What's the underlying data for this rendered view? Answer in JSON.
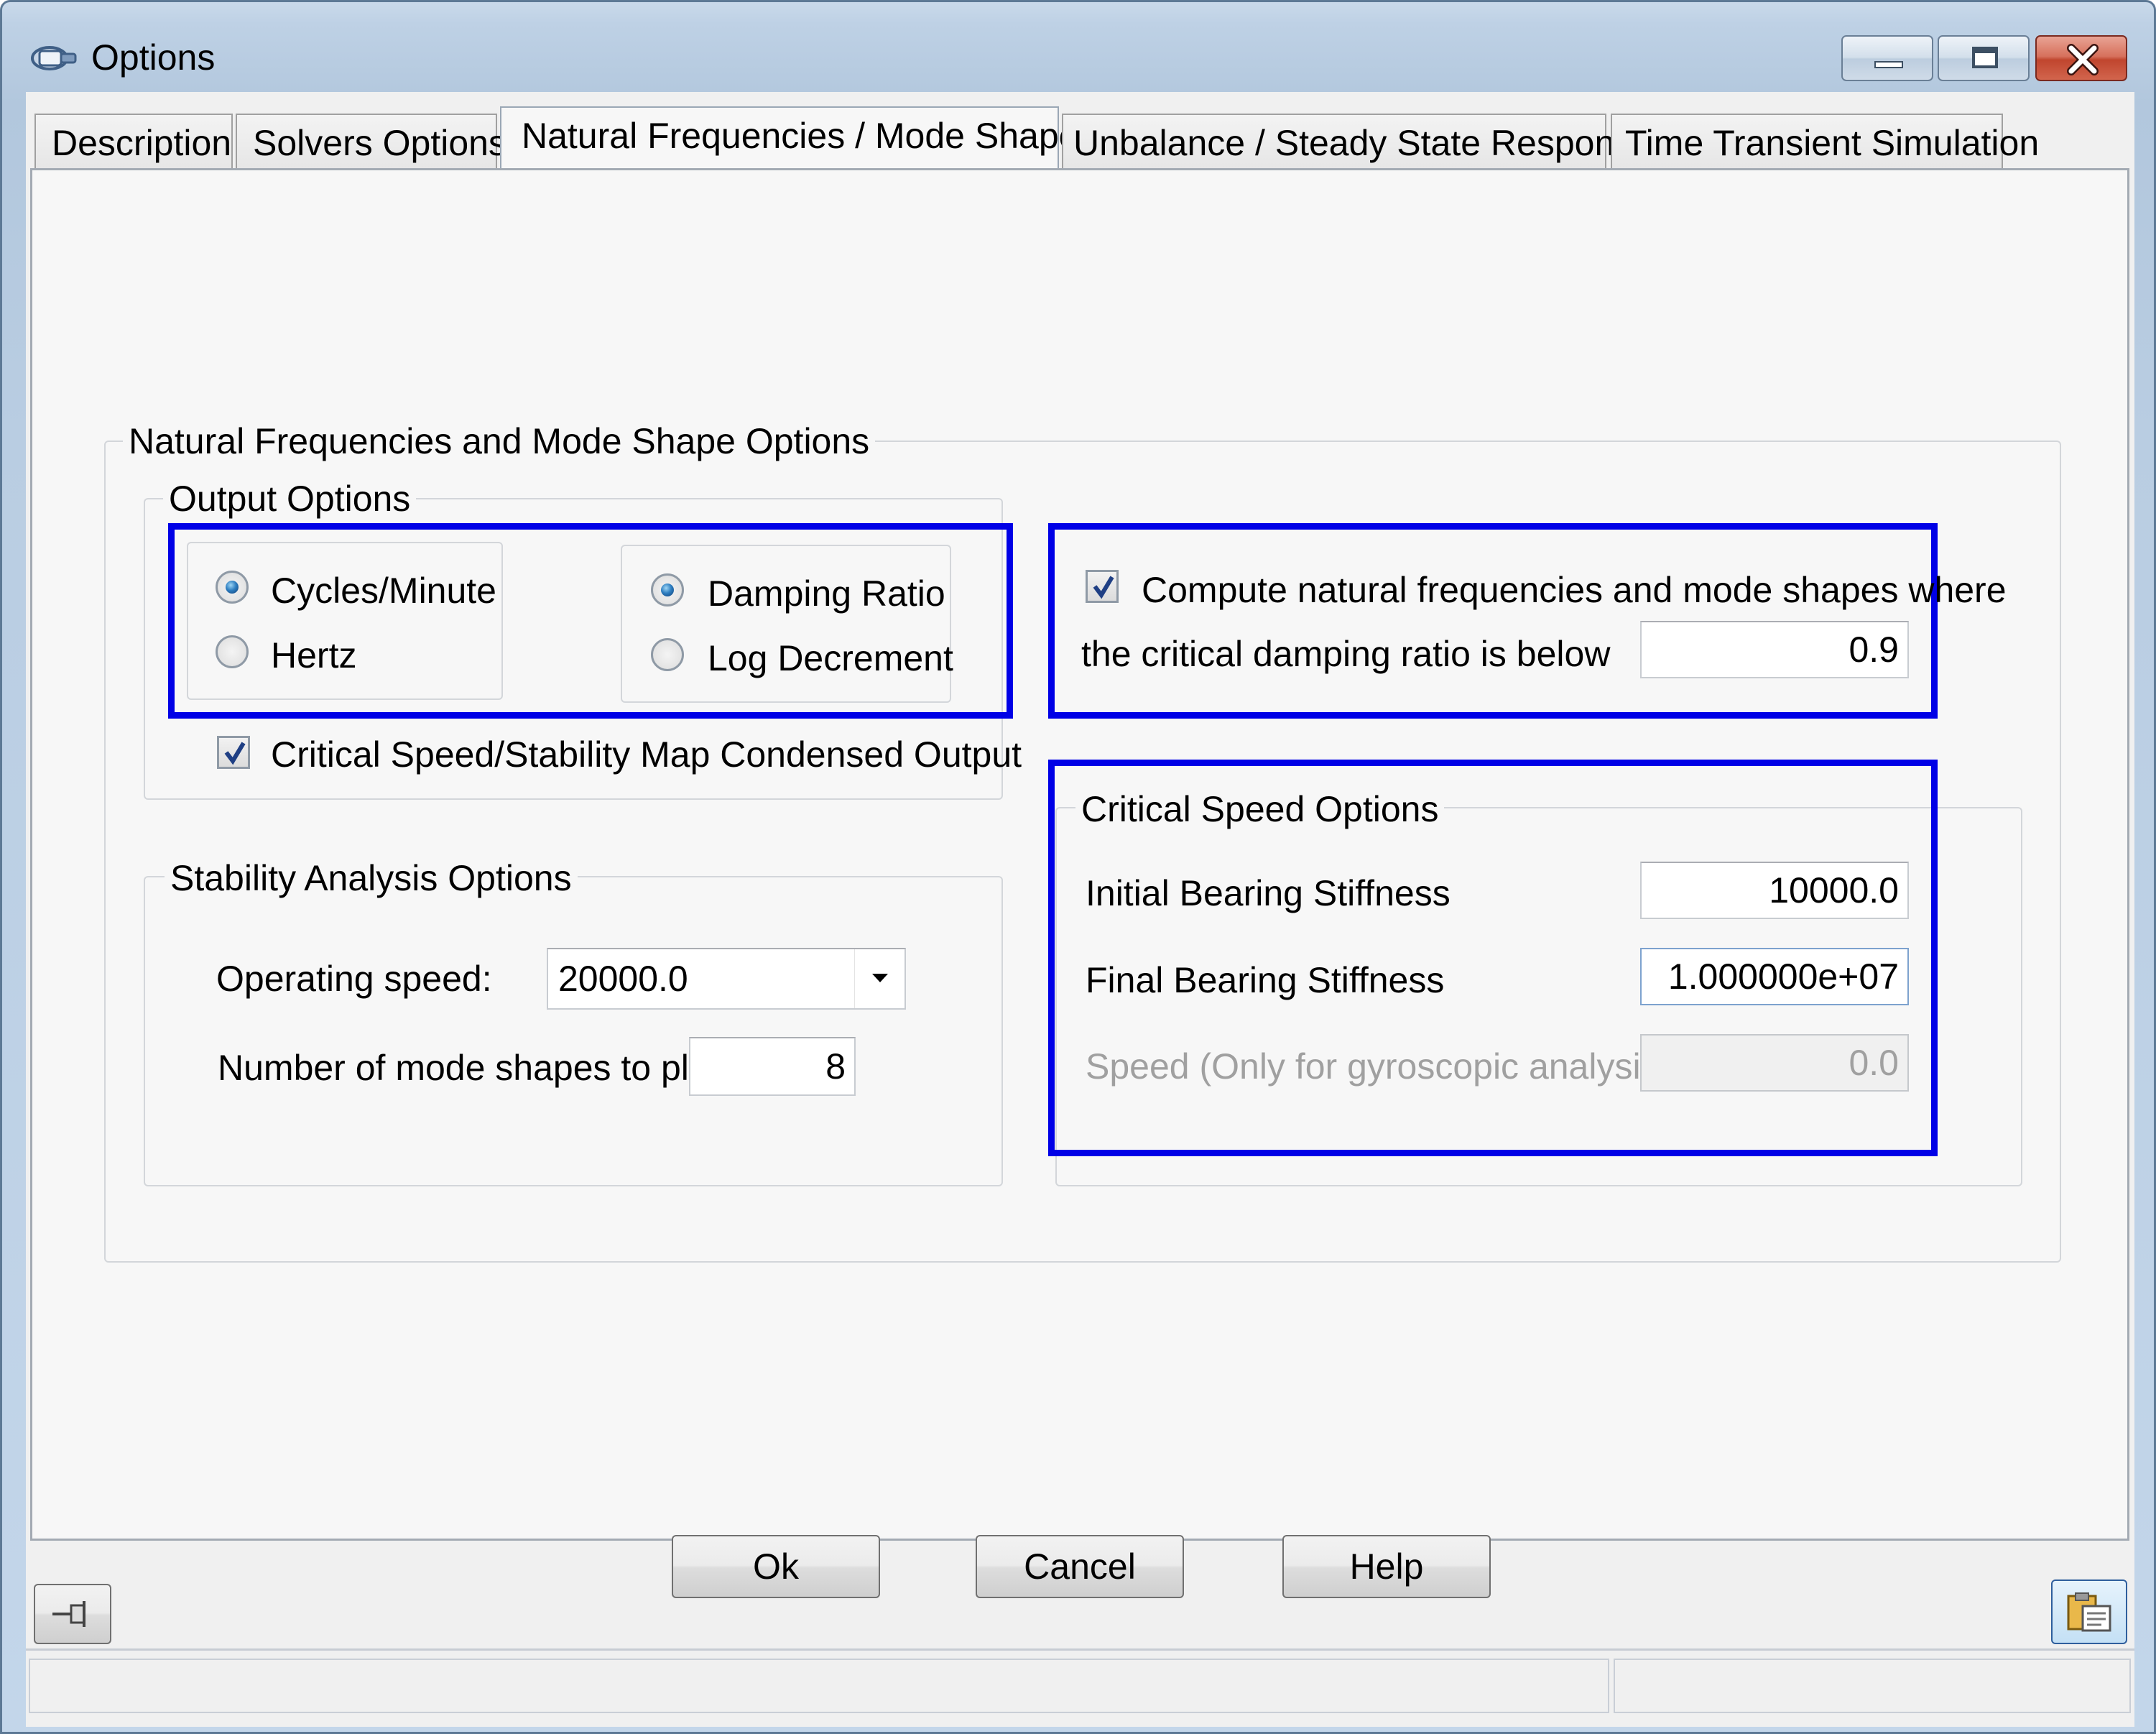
{
  "window": {
    "title": "Options"
  },
  "tabs": [
    {
      "label": "Description",
      "active": false
    },
    {
      "label": "Solvers Options",
      "active": false
    },
    {
      "label": "Natural Frequencies / Mode Shapes",
      "active": true
    },
    {
      "label": "Unbalance / Steady State Response",
      "active": false
    },
    {
      "label": "Time Transient Simulation",
      "active": false
    }
  ],
  "main": {
    "group_title": "Natural Frequencies and Mode Shape Options",
    "output_options": {
      "title": "Output Options",
      "units": {
        "cycles_minute": "Cycles/Minute",
        "hertz": "Hertz",
        "selected": "Cycles/Minute"
      },
      "damping": {
        "damping_ratio": "Damping Ratio",
        "log_decrement": "Log Decrement",
        "selected": "Damping Ratio"
      },
      "condensed_output": {
        "label": "Critical Speed/Stability Map Condensed Output",
        "checked": true
      }
    },
    "compute": {
      "line1": "Compute natural frequencies and mode shapes where",
      "line2": "the critical damping ratio is below",
      "checked": true,
      "value": "0.9"
    },
    "stability": {
      "title": "Stability Analysis Options",
      "operating_speed_label": "Operating speed:",
      "operating_speed_value": "20000.0",
      "mode_shapes_label": "Number of mode shapes to plot",
      "mode_shapes_value": "8"
    },
    "critical_speed": {
      "title": "Critical Speed Options",
      "initial_label": "Initial Bearing Stiffness",
      "initial_value": "10000.0",
      "final_label": "Final Bearing Stiffness",
      "final_value": "1.000000e+07",
      "speed_label": "Speed (Only for gyroscopic analysis)",
      "speed_value": "0.0"
    }
  },
  "buttons": {
    "ok": "Ok",
    "cancel": "Cancel",
    "help": "Help"
  },
  "colors": {
    "highlight": "#0000e6",
    "client_bg": "#f0f0f0",
    "frame": "#b9cde2"
  },
  "icons": {
    "title": "options-app-icon",
    "left_footer": "pin-icon",
    "right_footer": "clipboard-icon"
  }
}
